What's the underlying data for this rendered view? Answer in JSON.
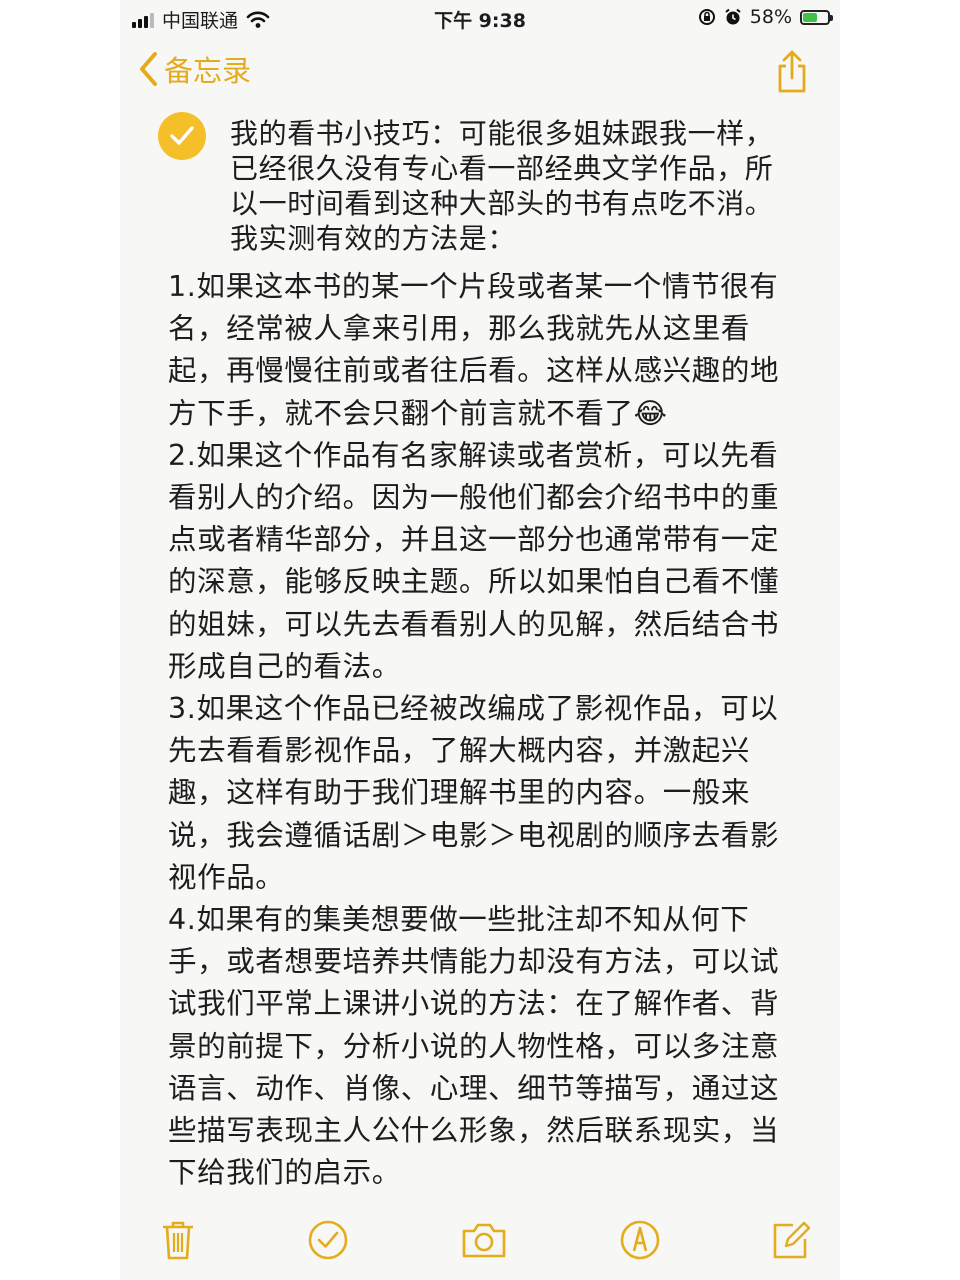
{
  "status_bar": {
    "carrier": "中国联通",
    "time": "下午 9:38",
    "battery_text": "58%",
    "battery_level": 0.58
  },
  "nav": {
    "back_label": "备忘录"
  },
  "note": {
    "checked": true,
    "intro": "我的看书小技巧：可能很多姐妹跟我一样，已经很久没有专心看一部经典文学作品，所以一时间看到这种大部头的书有点吃不消。我实测有效的方法是：",
    "paragraphs": [
      "1.如果这本书的某一个片段或者某一个情节很有名，经常被人拿来引用，那么我就先从这里看起，再慢慢往前或者往后看。这样从感兴趣的地方下手，就不会只翻个前言就不看了😂",
      "2.如果这个作品有名家解读或者赏析，可以先看看别人的介绍。因为一般他们都会介绍书中的重点或者精华部分，并且这一部分也通常带有一定的深意，能够反映主题。所以如果怕自己看不懂的姐妹，可以先去看看别人的见解，然后结合书形成自己的看法。",
      "3.如果这个作品已经被改编成了影视作品，可以先去看看影视作品，了解大概内容，并激起兴趣，这样有助于我们理解书里的内容。一般来说，我会遵循话剧＞电影＞电视剧的顺序去看影视作品。",
      "4.如果有的集美想要做一些批注却不知从何下手，或者想要培养共情能力却没有方法，可以试试我们平常上课讲小说的方法：在了解作者、背景的前提下，分析小说的人物性格，可以多注意语言、动作、肖像、心理、细节等描写，通过这些描写表现主人公什么形象，然后联系现实，当下给我们的启示。"
    ]
  },
  "colors": {
    "accent": "#e4ac1c",
    "check_fill": "#f5bf2a",
    "background": "#f7f7f5"
  },
  "toolbar": {
    "icons": [
      "trash-icon",
      "checklist-icon",
      "camera-icon",
      "markup-icon",
      "compose-icon"
    ]
  }
}
